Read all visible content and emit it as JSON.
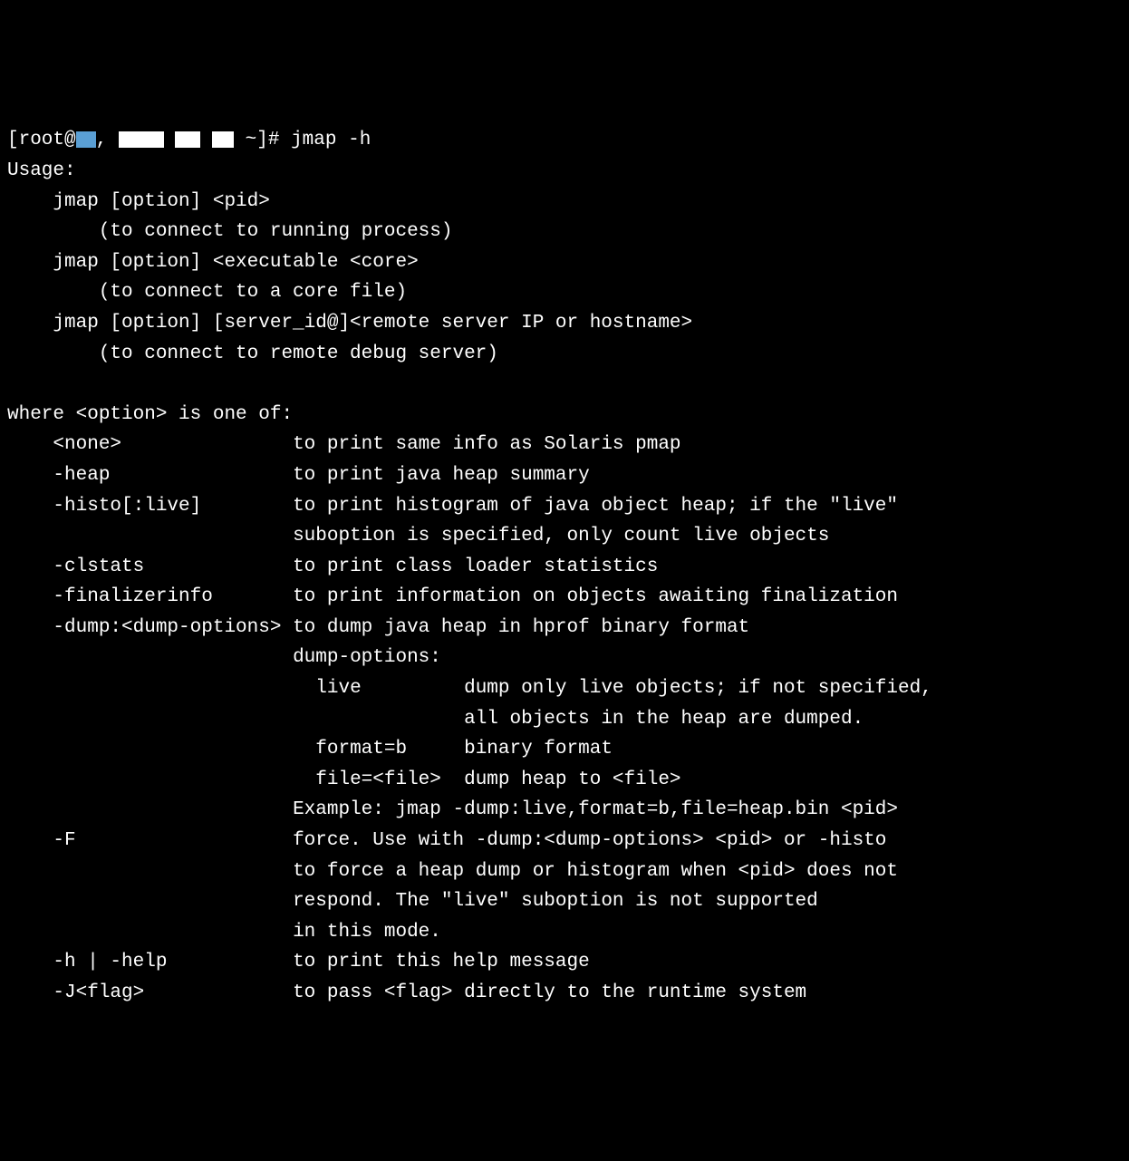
{
  "prompt": {
    "prefix": "[root@",
    "middle": ",",
    "suffix": " ~]# ",
    "command": "jmap -h"
  },
  "output": {
    "usage_header": "Usage:",
    "usage_lines": [
      "    jmap [option] <pid>",
      "        (to connect to running process)",
      "    jmap [option] <executable <core>",
      "        (to connect to a core file)",
      "    jmap [option] [server_id@]<remote server IP or hostname>",
      "        (to connect to remote debug server)"
    ],
    "where_header": "where <option> is one of:",
    "options": [
      {
        "flag": "    <none>               ",
        "desc": "to print same info as Solaris pmap"
      },
      {
        "flag": "    -heap                ",
        "desc": "to print java heap summary"
      },
      {
        "flag": "    -histo[:live]        ",
        "desc": "to print histogram of java object heap; if the \"live\""
      },
      {
        "flag": "                         ",
        "desc": "suboption is specified, only count live objects"
      },
      {
        "flag": "    -clstats             ",
        "desc": "to print class loader statistics"
      },
      {
        "flag": "    -finalizerinfo       ",
        "desc": "to print information on objects awaiting finalization"
      },
      {
        "flag": "    -dump:<dump-options> ",
        "desc": "to dump java heap in hprof binary format"
      },
      {
        "flag": "                         ",
        "desc": "dump-options:"
      },
      {
        "flag": "                         ",
        "desc": "  live         dump only live objects; if not specified,"
      },
      {
        "flag": "                         ",
        "desc": "               all objects in the heap are dumped."
      },
      {
        "flag": "                         ",
        "desc": "  format=b     binary format"
      },
      {
        "flag": "                         ",
        "desc": "  file=<file>  dump heap to <file>"
      },
      {
        "flag": "                         ",
        "desc": "Example: jmap -dump:live,format=b,file=heap.bin <pid>"
      },
      {
        "flag": "    -F                   ",
        "desc": "force. Use with -dump:<dump-options> <pid> or -histo"
      },
      {
        "flag": "                         ",
        "desc": "to force a heap dump or histogram when <pid> does not"
      },
      {
        "flag": "                         ",
        "desc": "respond. The \"live\" suboption is not supported"
      },
      {
        "flag": "                         ",
        "desc": "in this mode."
      },
      {
        "flag": "    -h | -help           ",
        "desc": "to print this help message"
      },
      {
        "flag": "    -J<flag>             ",
        "desc": "to pass <flag> directly to the runtime system"
      }
    ]
  }
}
